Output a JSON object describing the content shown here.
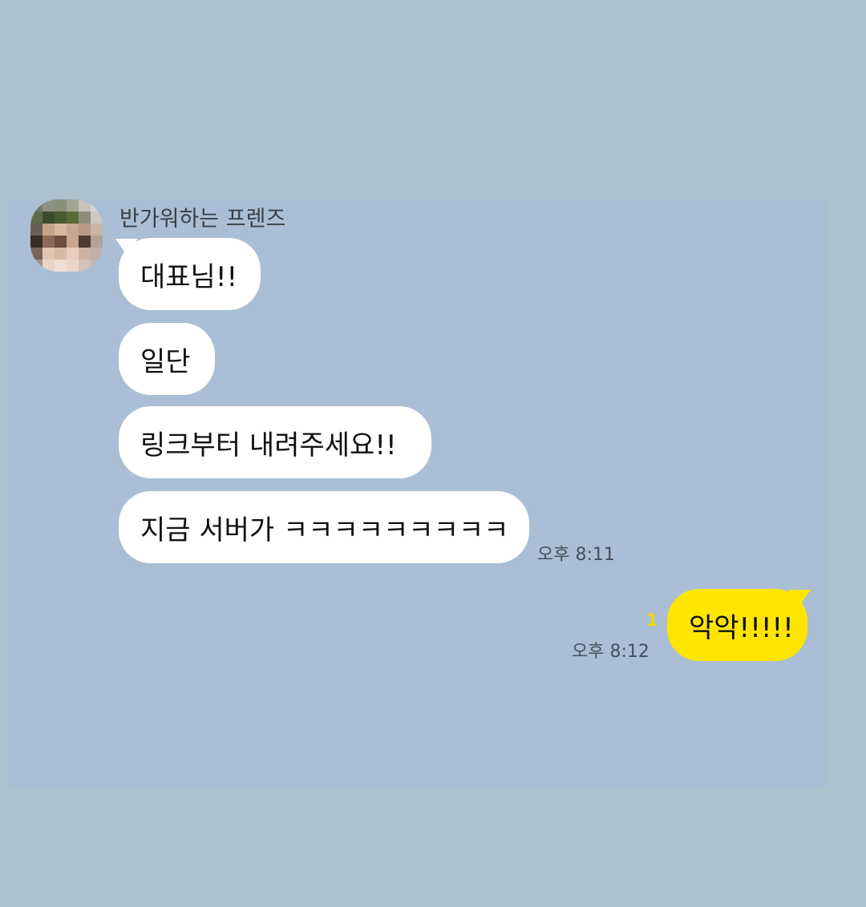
{
  "chat": {
    "sender_name": "반가워하는 프렌즈",
    "received_messages": [
      "대표님!!",
      "일단",
      "링크부터 내려주세요!!",
      "지금 서버가 ㅋㅋㅋㅋㅋㅋㅋㅋㅋ"
    ],
    "received_time": "오후 8:11",
    "sent_message": "악악!!!!!",
    "sent_time": "오후 8:12",
    "unread_count": "1"
  },
  "colors": {
    "background": "#adc3d0",
    "chat_panel": "#aabfd5",
    "received_bubble": "#ffffff",
    "sent_bubble": "#fee500",
    "unread_count": "#f2d800",
    "timestamp": "#45505c"
  },
  "icons": {
    "avatar": "pixelated-profile-avatar"
  }
}
